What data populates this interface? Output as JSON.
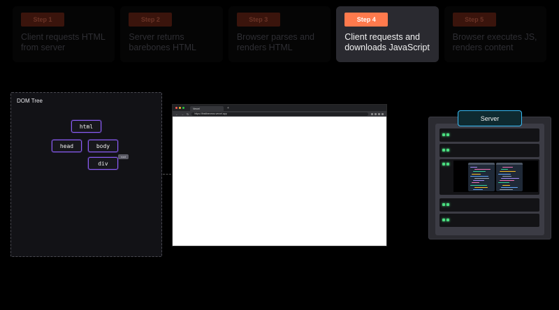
{
  "steps": [
    {
      "badge": "Step 1",
      "desc": "Client requests HTML from server",
      "active": false
    },
    {
      "badge": "Step 2",
      "desc": "Server returns barebones HTML",
      "active": false
    },
    {
      "badge": "Step 3",
      "desc": "Browser parses and renders HTML",
      "active": false
    },
    {
      "badge": "Step 4",
      "desc": "Client requests and downloads JavaScript",
      "active": true
    },
    {
      "badge": "Step 5",
      "desc": "Browser executes JS, renders content",
      "active": false
    }
  ],
  "dom_tree": {
    "title": "DOM Tree",
    "nodes": {
      "html": "html",
      "head": "head",
      "body": "body",
      "div": "div"
    },
    "tag": "root"
  },
  "browser": {
    "tab_title": "Vercel",
    "url": "https://firstthenews.vercel.app",
    "tab_plus": "+"
  },
  "server": {
    "label": "Server"
  },
  "colors": {
    "accent": "#ff7a4d",
    "node_border": "#8b5cf6",
    "server_border": "#38bdf8",
    "led": "#4ade80"
  }
}
